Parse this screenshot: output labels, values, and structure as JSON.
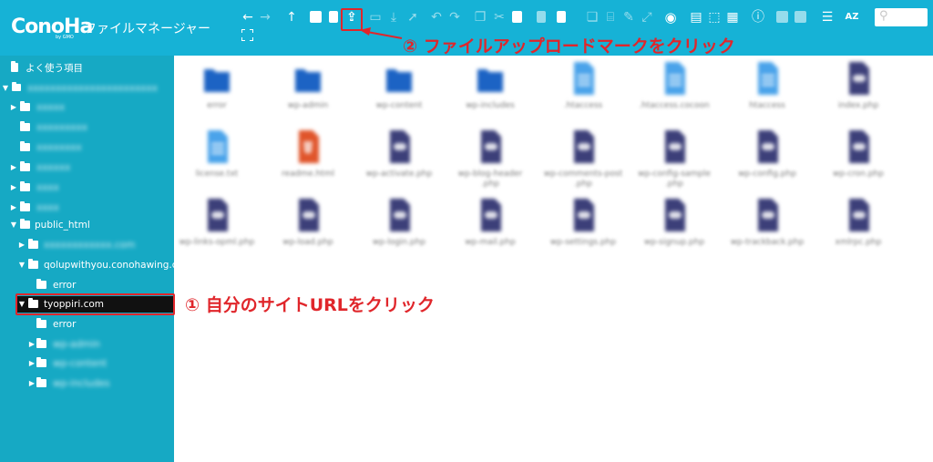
{
  "header": {
    "logo": "ConoHa",
    "logo_sub": "by GMO",
    "title": "ファイルマネージャー",
    "search_placeholder": ""
  },
  "toolbar": {
    "icons": [
      "back-icon",
      "forward-icon",
      "up-icon",
      "new-folder-icon",
      "new-file-icon",
      "upload-icon",
      "open-folder-icon",
      "download-icon",
      "select-icon",
      "undo-icon",
      "redo-icon",
      "copy-icon",
      "cut-icon",
      "paste-icon",
      "delete-icon",
      "duplicate-icon",
      "rename-icon",
      "edit-icon",
      "resize-icon",
      "preview-icon",
      "select-all-icon",
      "select-none-icon",
      "invert-icon",
      "info-icon",
      "extract-icon",
      "archive-icon",
      "view-list-icon",
      "sort-icon",
      "search-icon",
      "fullscreen-icon"
    ]
  },
  "annotations": {
    "note1": "① 自分のサイトURLをクリック",
    "note2": "② ファイルアップロードマークをクリック",
    "color": "#e0262b"
  },
  "sidebar": {
    "favorites": "よく使う項目",
    "root": "xxxxxxxxxxxxxxxxxxxxxxx",
    "items": [
      {
        "label": "xxxxx"
      },
      {
        "label": "xxxxxxxxx"
      },
      {
        "label": "xxxxxxxx"
      },
      {
        "label": "xxxxxx"
      },
      {
        "label": "xxxx"
      },
      {
        "label": "xxxx"
      },
      {
        "label": "public_html"
      },
      {
        "label": "xxxxxxxxxxxx.com"
      },
      {
        "label": "qolupwithyou.conohawing.com"
      },
      {
        "label": "error"
      },
      {
        "label": "tyoppiri.com"
      },
      {
        "label": "error"
      },
      {
        "label": "wp-admin"
      },
      {
        "label": "wp-content"
      },
      {
        "label": "wp-includes"
      }
    ]
  },
  "files": [
    {
      "name": "error",
      "type": "folder"
    },
    {
      "name": "wp-admin",
      "type": "folder"
    },
    {
      "name": "wp-content",
      "type": "folder"
    },
    {
      "name": "wp-includes",
      "type": "folder"
    },
    {
      "name": ".htaccess",
      "type": "text"
    },
    {
      "name": ".htaccess.cocoon",
      "type": "text"
    },
    {
      "name": "htaccess",
      "type": "text"
    },
    {
      "name": "index.php",
      "type": "php"
    },
    {
      "name": "license.txt",
      "type": "text"
    },
    {
      "name": "readme.html",
      "type": "html"
    },
    {
      "name": "wp-activate.php",
      "type": "php"
    },
    {
      "name": "wp-blog-header",
      "name2": ".php",
      "type": "php"
    },
    {
      "name": "wp-comments-post",
      "name2": ".php",
      "type": "php"
    },
    {
      "name": "wp-config-sample",
      "name2": ".php",
      "type": "php"
    },
    {
      "name": "wp-config.php",
      "type": "php"
    },
    {
      "name": "wp-cron.php",
      "type": "php"
    },
    {
      "name": "wp-links-opml.php",
      "type": "php"
    },
    {
      "name": "wp-load.php",
      "type": "php"
    },
    {
      "name": "wp-login.php",
      "type": "php"
    },
    {
      "name": "wp-mail.php",
      "type": "php"
    },
    {
      "name": "wp-settings.php",
      "type": "php"
    },
    {
      "name": "wp-signup.php",
      "type": "php"
    },
    {
      "name": "wp-trackback.php",
      "type": "php"
    },
    {
      "name": "xmlrpc.php",
      "type": "php"
    }
  ],
  "colors": {
    "header": "#16b2d6",
    "sidebar": "#16a9c4",
    "folder": "#1c63c4",
    "text_file": "#4aa3ea",
    "php_file": "#3c3f79",
    "html_file": "#e0552b"
  }
}
